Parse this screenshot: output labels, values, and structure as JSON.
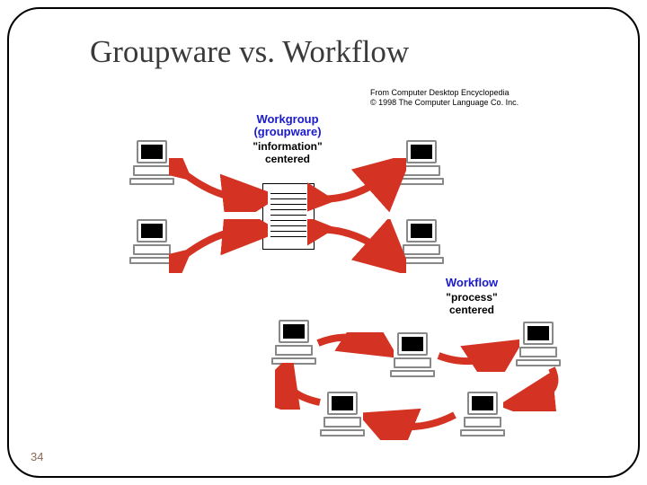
{
  "title": "Groupware vs. Workflow",
  "attribution": {
    "line1": "From Computer Desktop Encyclopedia",
    "line2": "© 1998 The Computer Language Co. Inc."
  },
  "workgroup": {
    "heading": "Workgroup\n(groupware)",
    "subheading": "\"information\"\ncentered"
  },
  "workflow": {
    "heading": "Workflow",
    "subheading": "\"process\"\ncentered"
  },
  "page_number": "34",
  "notes": {
    "groupware_description": "Four computers connected via bidirectional arrows to a central shared document (information-centered collaboration).",
    "workflow_description": "Five computers connected in a sequential chain by arrows (process-centered routing)."
  }
}
